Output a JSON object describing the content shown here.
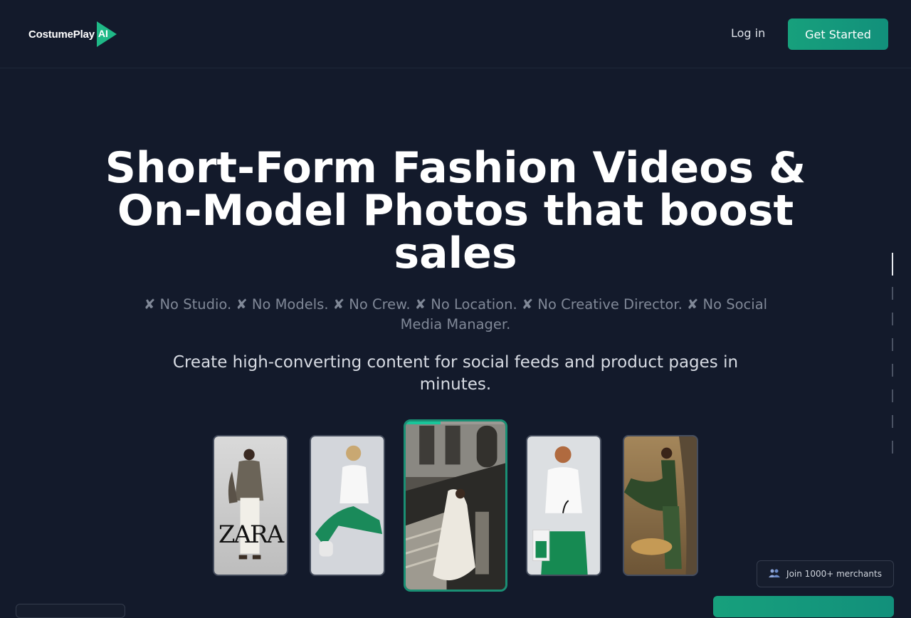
{
  "brand": {
    "name": "CostumePlay",
    "suffix": "AI",
    "accent": "#1fb987"
  },
  "nav": {
    "login_label": "Log in",
    "cta_label": "Get Started"
  },
  "hero": {
    "headline": "Short-Form Fashion Videos & On-Model Photos that boost sales",
    "negatives": "✘ No Studio.  ✘ No Models.  ✘ No Crew.  ✘ No Location.  ✘ No Creative Director.  ✘ No Social Media Manager.",
    "subtitle": "Create high-converting content for social feeds and product pages in minutes."
  },
  "carousel": {
    "items": [
      {
        "name": "model-zara",
        "logo_text": "ZARA"
      },
      {
        "name": "model-seated-green"
      },
      {
        "name": "model-bridal-staircase",
        "active": true,
        "progress": 0.35
      },
      {
        "name": "model-green-trousers"
      },
      {
        "name": "model-green-gown-leopard"
      }
    ]
  },
  "side_indicator": {
    "count": 8,
    "active_index": 0
  },
  "badge": {
    "icon": "people-icon",
    "text": "Join 1000+ merchants"
  },
  "colors": {
    "background": "#131a2b",
    "cta": "#17a07c",
    "active_border": "#1a8f74"
  }
}
